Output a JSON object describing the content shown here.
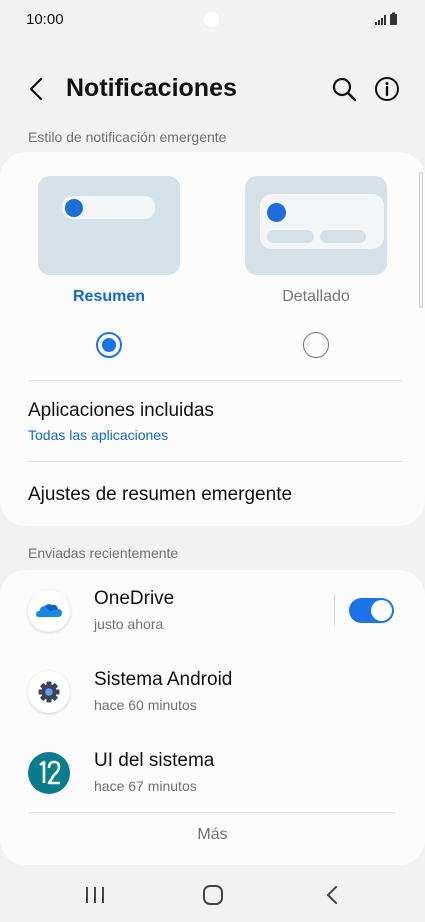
{
  "status_bar": {
    "time": "10:00"
  },
  "header": {
    "title": "Notificaciones"
  },
  "popup_section": {
    "label": "Estilo de notificación emergente",
    "options": [
      {
        "label": "Resumen",
        "selected": true
      },
      {
        "label": "Detallado",
        "selected": false
      }
    ],
    "included_apps": {
      "title": "Aplicaciones incluidas",
      "value": "Todas las aplicaciones"
    },
    "summary_settings": {
      "title": "Ajustes de resumen emergente"
    }
  },
  "recent_section": {
    "label": "Enviadas recientemente",
    "apps": [
      {
        "name": "OneDrive",
        "time": "justo ahora",
        "icon": "onedrive-icon",
        "toggle_on": true
      },
      {
        "name": "Sistema Android",
        "time": "hace 60 minutos",
        "icon": "android-system-gear-icon"
      },
      {
        "name": "UI del sistema",
        "time": "hace 67 minutos",
        "icon": "one-ui-12-icon"
      }
    ],
    "more_label": "Más"
  },
  "colors": {
    "accent": "#1a73e8",
    "card": "#fcfcfc",
    "background": "#f2f2f2"
  }
}
